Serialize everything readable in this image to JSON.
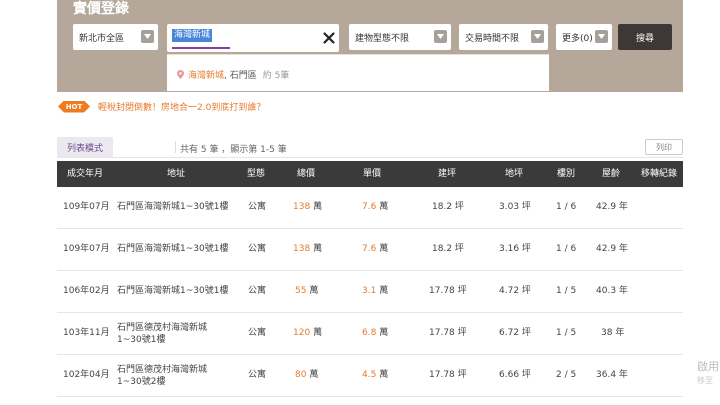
{
  "panel": {
    "title": "實價登錄",
    "district": "新北市全區",
    "search_value": "海灣新城",
    "building_type": "建物型態不限",
    "trade_time": "交易時間不限",
    "more": "更多(0)",
    "search_button": "搜尋"
  },
  "suggestion": {
    "highlight": "海灣新城",
    "location": ", 石門區",
    "count": "約 5筆"
  },
  "hot": {
    "badge": "HOT",
    "link": "輕稅封閉倒數！房地合一2.0到底打到誰？"
  },
  "list": {
    "tab_label": "列表模式",
    "count_text": "共有 5 筆 ，顯示第 1-5 筆",
    "print_label": "列印"
  },
  "table": {
    "headers": [
      "成交年月",
      "地址",
      "型態",
      "總價",
      "單價",
      "建坪",
      "地坪",
      "樓別",
      "屋齡",
      "移轉紀錄"
    ],
    "rows": [
      {
        "date": "109年07月",
        "addr1": "石門區海灣新城1~30號1樓",
        "addr2": "",
        "type": "公寓",
        "total": "138",
        "total_unit": "萬",
        "unit_price": "7.6",
        "unit_price_unit": "萬",
        "building": "18.2 坪",
        "land": "3.03 坪",
        "floor": "1 / 6",
        "age": "42.9 年"
      },
      {
        "date": "109年07月",
        "addr1": "石門區海灣新城1~30號1樓",
        "addr2": "",
        "type": "公寓",
        "total": "138",
        "total_unit": "萬",
        "unit_price": "7.6",
        "unit_price_unit": "萬",
        "building": "18.2 坪",
        "land": "3.16 坪",
        "floor": "1 / 6",
        "age": "42.9 年"
      },
      {
        "date": "106年02月",
        "addr1": "石門區海灣新城1~30號1樓",
        "addr2": "",
        "type": "公寓",
        "total": "55",
        "total_unit": "萬",
        "unit_price": "3.1",
        "unit_price_unit": "萬",
        "building": "17.78 坪",
        "land": "4.72 坪",
        "floor": "1 / 5",
        "age": "40.3 年"
      },
      {
        "date": "103年11月",
        "addr1": "石門區德茂村海灣新城",
        "addr2": "1~30號1樓",
        "type": "公寓",
        "total": "120",
        "total_unit": "萬",
        "unit_price": "6.8",
        "unit_price_unit": "萬",
        "building": "17.78 坪",
        "land": "6.72 坪",
        "floor": "1 / 5",
        "age": "38 年"
      },
      {
        "date": "102年04月",
        "addr1": "石門區德茂村海灣新城",
        "addr2": "1~30號2樓",
        "type": "公寓",
        "total": "80",
        "total_unit": "萬",
        "unit_price": "4.5",
        "unit_price_unit": "萬",
        "building": "17.78 坪",
        "land": "6.66 坪",
        "floor": "2 / 5",
        "age": "36.4 年"
      }
    ]
  },
  "watermark": {
    "line1": "啟用",
    "line2": "移至"
  }
}
